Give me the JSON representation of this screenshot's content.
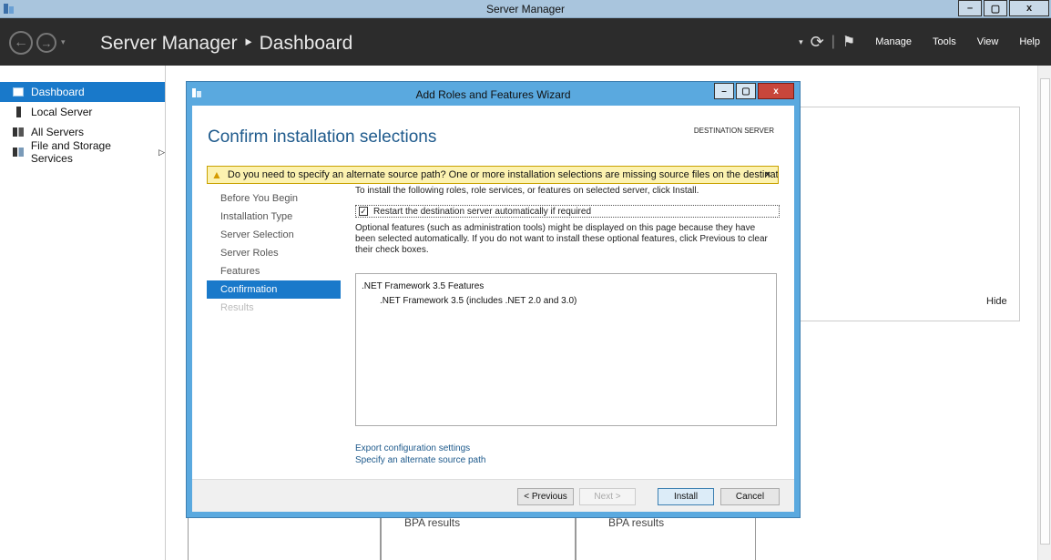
{
  "window": {
    "title": "Server Manager",
    "btn_min": "–",
    "btn_max": "▢",
    "btn_close": "x"
  },
  "header": {
    "breadcrumb": "Server Manager ‣ Dashboard",
    "menu": [
      "Manage",
      "Tools",
      "View",
      "Help"
    ],
    "separator": "|"
  },
  "sidebar": {
    "items": [
      {
        "label": "Dashboard",
        "icon": "dashboard-icon",
        "active": true
      },
      {
        "label": "Local Server",
        "icon": "server-icon"
      },
      {
        "label": "All Servers",
        "icon": "servers-icon"
      },
      {
        "label": "File and Storage Services",
        "icon": "storage-icon",
        "arrow": "▷"
      }
    ]
  },
  "dashboard": {
    "hide_label": "Hide",
    "bpa_label_1": "BPA results",
    "bpa_label_2": "BPA results"
  },
  "wizard": {
    "title": "Add Roles and Features Wizard",
    "heading": "Confirm installation selections",
    "destination_label": "DESTINATION SERVER",
    "warning": "Do you need to specify an alternate source path? One or more installation selections are missing source files on the destinati...",
    "warning_close": "×",
    "steps": [
      {
        "label": "Before You Begin"
      },
      {
        "label": "Installation Type"
      },
      {
        "label": "Server Selection"
      },
      {
        "label": "Server Roles"
      },
      {
        "label": "Features"
      },
      {
        "label": "Confirmation",
        "active": true
      },
      {
        "label": "Results",
        "disabled": true
      }
    ],
    "intro": "To install the following roles, role services, or features on selected server, click Install.",
    "restart_checkbox": {
      "label": "Restart the destination server automatically if required",
      "checked": true
    },
    "optional_text": "Optional features (such as administration tools) might be displayed on this page because they have been selected automatically. If you do not want to install these optional features, click Previous to clear their check boxes.",
    "features": [
      {
        "label": ".NET Framework 3.5 Features",
        "level": 0
      },
      {
        "label": ".NET Framework 3.5 (includes .NET 2.0 and 3.0)",
        "level": 1
      }
    ],
    "links": {
      "export": "Export configuration settings",
      "alt_source": "Specify an alternate source path"
    },
    "buttons": {
      "previous": "< Previous",
      "next": "Next >",
      "install": "Install",
      "cancel": "Cancel"
    }
  },
  "colors": {
    "accent": "#1979ca",
    "header_bg": "#2c2c2c",
    "wizard_frame": "#5aa9df",
    "warning_bg": "#fcf2b0"
  }
}
